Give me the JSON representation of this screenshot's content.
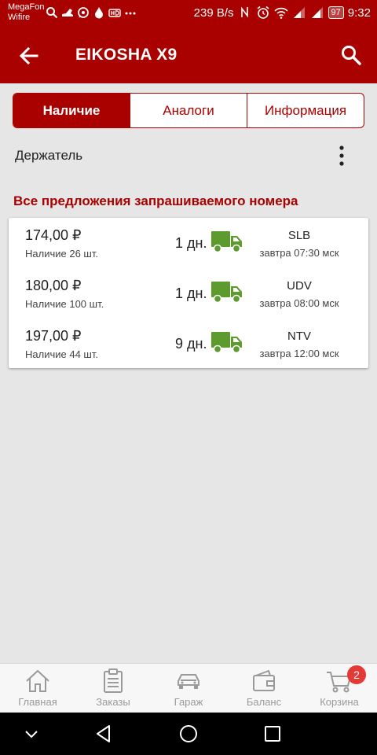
{
  "status_bar": {
    "carrier_line1": "MegaFon",
    "carrier_line2": "Wifire",
    "speed": "239 B/s",
    "battery": "97",
    "time": "9:32"
  },
  "app_bar": {
    "title": "EIKOSHA X9",
    "back_icon": "arrow-left-icon",
    "search_icon": "search-icon"
  },
  "tabs": [
    {
      "label": "Наличие",
      "active": true
    },
    {
      "label": "Аналоги",
      "active": false
    },
    {
      "label": "Информация",
      "active": false
    }
  ],
  "holder": {
    "label": "Держатель",
    "menu_icon": "more-vertical-icon"
  },
  "offers": {
    "title": "Все предложения запрашиваемого номера",
    "items": [
      {
        "price": "174,00 ₽",
        "stock": "Наличие 26 шт.",
        "days": "1 дн.",
        "supplier": "SLB",
        "delivery": "завтра 07:30 мск"
      },
      {
        "price": "180,00 ₽",
        "stock": "Наличие 100 шт.",
        "days": "1 дн.",
        "supplier": "UDV",
        "delivery": "завтра 08:00 мск"
      },
      {
        "price": "197,00 ₽",
        "stock": "Наличие 44 шт.",
        "days": "9 дн.",
        "supplier": "NTV",
        "delivery": "завтра 12:00 мск"
      }
    ]
  },
  "bottom_nav": {
    "items": [
      {
        "label": "Главная",
        "icon": "home-icon"
      },
      {
        "label": "Заказы",
        "icon": "clipboard-icon"
      },
      {
        "label": "Гараж",
        "icon": "car-icon"
      },
      {
        "label": "Баланс",
        "icon": "wallet-icon"
      },
      {
        "label": "Корзина",
        "icon": "cart-icon"
      }
    ],
    "cart_badge": "2"
  },
  "colors": {
    "primary": "#a90000",
    "truck_green": "#5d9b2f",
    "badge": "#e53935"
  }
}
